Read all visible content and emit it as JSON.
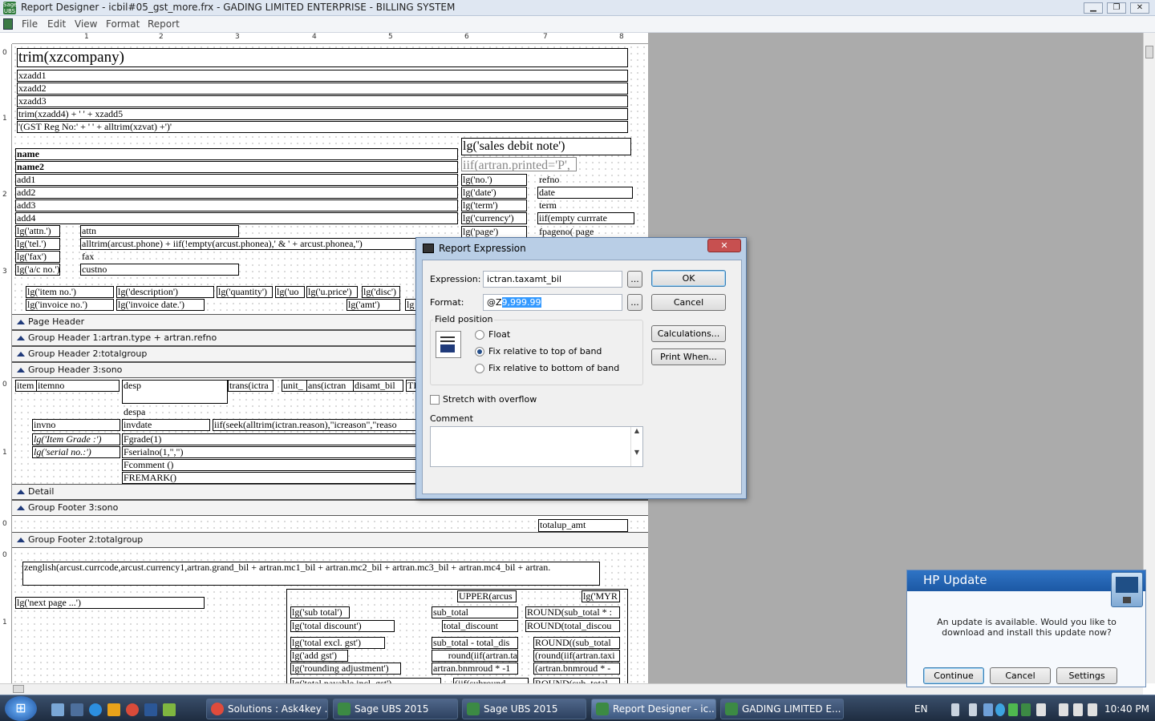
{
  "window": {
    "title": "Report Designer - icbil#05_gst_more.frx - GADING LIMITED ENTERPRISE - BILLING SYSTEM",
    "min": "▁",
    "max": "❐",
    "close": "✕"
  },
  "menu": [
    "File",
    "Edit",
    "View",
    "Format",
    "Report"
  ],
  "ruler": {
    "h": [
      "1",
      "2",
      "3",
      "4",
      "5",
      "6",
      "7",
      "8"
    ],
    "v": [
      "0",
      "1",
      "2",
      "3",
      "0",
      "1",
      "0",
      "0",
      "1"
    ]
  },
  "header_fields": {
    "company": "trim(xzcompany)",
    "xzadd1": "xzadd1",
    "xzadd2": "xzadd2",
    "xzadd3": "xzadd3",
    "xzadd45": "trim(xzadd4) + ' ' + xzadd5",
    "gst": "'(GST Reg No:' + ' ' + alltrim(xzvat) +')'",
    "name": "name",
    "name2": "name2",
    "add1": "add1",
    "add2": "add2",
    "add3": "add3",
    "add4": "add4",
    "lg_attn": "lg('attn.')",
    "attn": "attn",
    "lg_tel": "lg('tel.')",
    "phone": "alltrim(arcust.phone) + iif(!empty(arcust.phonea),' & ' + arcust.phonea,'')",
    "lg_fax": "lg('fax')",
    "fax": "fax",
    "lg_ac": "lg('a/c no.')",
    "custno": "custno",
    "title": "lg('sales debit note')",
    "printed": "iif(artran.printed='P',",
    "lg_no": "lg('no.')",
    "refno": "refno",
    "lg_date": "lg('date')",
    "date": "date",
    "lg_term": "lg('term')",
    "term": "term",
    "lg_curr": "lg('currency')",
    "currate": "iif(empty currrate",
    "lg_page": "lg('page')",
    "pageno": "fpageno( page"
  },
  "col_heads": {
    "item": "lg('item no.')",
    "desc": "lg('description')",
    "qty": "lg('quantity')",
    "uom": "lg('uo",
    "uprice": "lg('u.price')",
    "disc": "lg('disc')",
    "inv": "lg('invoice no.')",
    "invdate": "lg('invoice date.')",
    "amt": "lg('amt')",
    "lg": "lg"
  },
  "bands": {
    "page_header": "Page Header",
    "gh1": "Group Header 1:artran.type +  artran.refno",
    "gh2": "Group Header 2:totalgroup",
    "gh3": "Group Header 3:sono",
    "detail": "Detail",
    "gf3": "Group Footer 3:sono",
    "gf2": "Group Footer 2:totalgroup"
  },
  "detail_fields": {
    "item": "item",
    "itemno": "itemno",
    "desp": "desp",
    "trans": "trans(ictra",
    "unit": "unit_",
    "trans2": "ans(ictran",
    "disamt": "disamt_bil",
    "ti": "TI",
    "despa": "despa",
    "invno": "invno",
    "invdate": "invdate",
    "reason": "iif(seek(alltrim(ictran.reason),\"icreason\",\"reaso",
    "grade_lbl": "lg('Item Grade :')",
    "grade": "Fgrade(1)",
    "serial_lbl": "lg('serial no.:')",
    "serial": "Fserialno(1,\",\")",
    "comment": "Fcomment ()",
    "remark": "FREMARK()"
  },
  "footer_fields": {
    "totalup": "totalup_amt",
    "zenglish": "zenglish(arcust.currcode,arcust.currency1,artran.grand_bil +  artran.mc1_bil +  artran.mc2_bil + artran.mc3_bil + artran.mc4_bil + artran.",
    "nextpage": "lg('next page ...')",
    "upper": "UPPER(arcus",
    "myr": "lg('MYR",
    "lg_sub": "lg('sub total')",
    "sub": "sub_total",
    "round_sub": "ROUND(sub_total * :",
    "lg_tdisc": "lg('total discount')",
    "tdisc": "total_discount",
    "round_tdisc": "ROUND(total_discou",
    "lg_excl": "lg('total excl. gst')",
    "subminus": "sub_total - total_dis",
    "round_sub2": "ROUND((sub_total",
    "lg_gst": "lg('add gst')",
    "roundiif": "round(iif(artran.ta",
    "roundiif2": "(round(iif(artran.taxi",
    "lg_radj": "lg('rounding adjustment')",
    "bnm": "artran.bnmroud * -1",
    "bnm2": "(artran.bnmroud * -",
    "lg_payable": "lg('total payable incl. gst')",
    "iifsub": "(iif(subround",
    "rounds": "ROUND(sub_total"
  },
  "dialog": {
    "title": "Report Expression",
    "close": "✕",
    "expression_label": "Expression:",
    "expression_value": "ictran.taxamt_bil",
    "format_label": "Format:",
    "format_prefix": "@Z",
    "format_selected": "9,999.99",
    "ellipsis": "...",
    "ok": "OK",
    "cancel": "Cancel",
    "calculations": "Calculations...",
    "print_when": "Print When...",
    "field_position": "Field position",
    "float": "Float",
    "fix_top": "Fix relative to top of band",
    "fix_bottom": "Fix relative to bottom of band",
    "selected_position": "fix_top",
    "stretch": "Stretch with overflow",
    "stretch_checked": false,
    "comment_label": "Comment",
    "comment_value": ""
  },
  "hp_update": {
    "title": "HP Update",
    "message": "An update is available. Would you like to download and install this update now?",
    "continue": "Continue",
    "cancel": "Cancel",
    "settings": "Settings"
  },
  "taskbar": {
    "start": "⊞",
    "items": [
      {
        "label": "Solutions : Ask4key ...",
        "color": "#e04b3c"
      },
      {
        "label": "Sage UBS 2015",
        "color": "#3c8a44"
      },
      {
        "label": "Sage UBS 2015",
        "color": "#3c8a44"
      },
      {
        "label": "Report Designer - ic...",
        "color": "#3c8a44"
      },
      {
        "label": "GADING LIMITED E...",
        "color": "#3c8a44"
      }
    ],
    "lang": "EN",
    "time": "10:40 PM"
  }
}
